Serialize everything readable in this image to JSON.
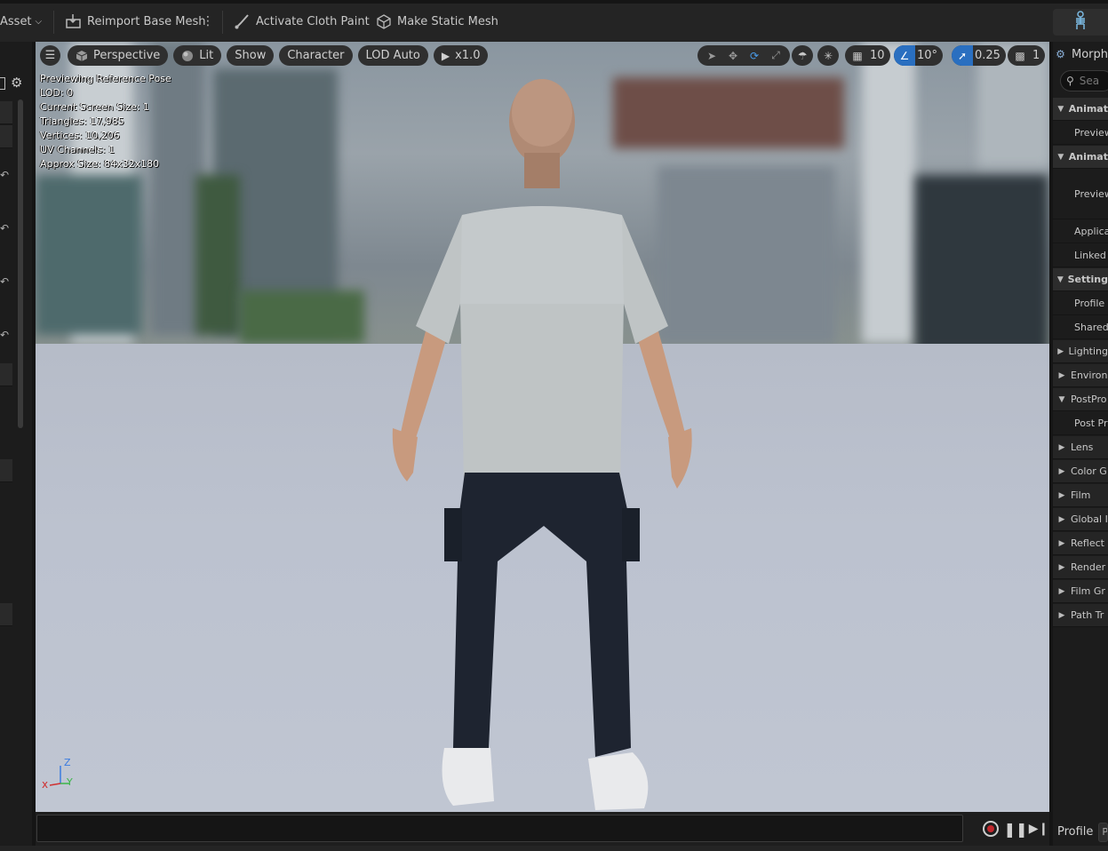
{
  "toolbar": {
    "asset_label": "Asset",
    "reimport_label": "Reimport Base Mesh",
    "cloth_paint_label": "Activate Cloth Paint",
    "static_mesh_label": "Make Static Mesh"
  },
  "viewport": {
    "view_mode": "Perspective",
    "lighting": "Lit",
    "show_label": "Show",
    "character_label": "Character",
    "lod_label": "LOD Auto",
    "play_speed": "x1.0",
    "grid_snap_value": "10",
    "rotation_snap_value": "10°",
    "scale_snap_value": "0.25",
    "camera_speed_value": "1",
    "stats": [
      "Previewing Reference Pose",
      "LOD: 0",
      "Current Screen Size: 1",
      "Triangles: 17,985",
      "Vertices: 10,206",
      "UV Channels: 1",
      "Approx Size: 84x32x180"
    ],
    "axis_labels": {
      "z": "Z",
      "x": "x",
      "y": "Y"
    }
  },
  "right_panel": {
    "title": "Morph",
    "search_placeholder": "Sea",
    "rows": [
      {
        "label": "Animat",
        "kind": "section",
        "open": true
      },
      {
        "label": "Preview",
        "kind": "item"
      },
      {
        "label": "Animat",
        "kind": "section",
        "open": true
      },
      {
        "label": "Preview",
        "kind": "item-tall"
      },
      {
        "label": "Applica",
        "kind": "item"
      },
      {
        "label": "Linked",
        "kind": "item"
      },
      {
        "label": "Setting",
        "kind": "section",
        "open": true
      },
      {
        "label": "Profile",
        "kind": "item"
      },
      {
        "label": "Shared",
        "kind": "item"
      },
      {
        "label": "Lighting",
        "kind": "sub",
        "open": false
      },
      {
        "label": "Environ",
        "kind": "sub",
        "open": false
      },
      {
        "label": "PostPro",
        "kind": "sub",
        "open": true
      },
      {
        "label": "Post Pr",
        "kind": "item"
      },
      {
        "label": "Lens",
        "kind": "sub",
        "open": false
      },
      {
        "label": "Color G",
        "kind": "sub",
        "open": false
      },
      {
        "label": "Film",
        "kind": "sub",
        "open": false
      },
      {
        "label": "Global I",
        "kind": "sub",
        "open": false
      },
      {
        "label": "Reflect",
        "kind": "sub",
        "open": false
      },
      {
        "label": "Render",
        "kind": "sub",
        "open": false
      },
      {
        "label": "Film Gr",
        "kind": "sub",
        "open": false
      },
      {
        "label": "Path Tr",
        "kind": "sub",
        "open": false
      }
    ],
    "footer_label": "Profile",
    "footer_mini": "Pr"
  },
  "colors": {
    "accent_blue": "#2a6fc0",
    "record_red": "#c0282d"
  }
}
